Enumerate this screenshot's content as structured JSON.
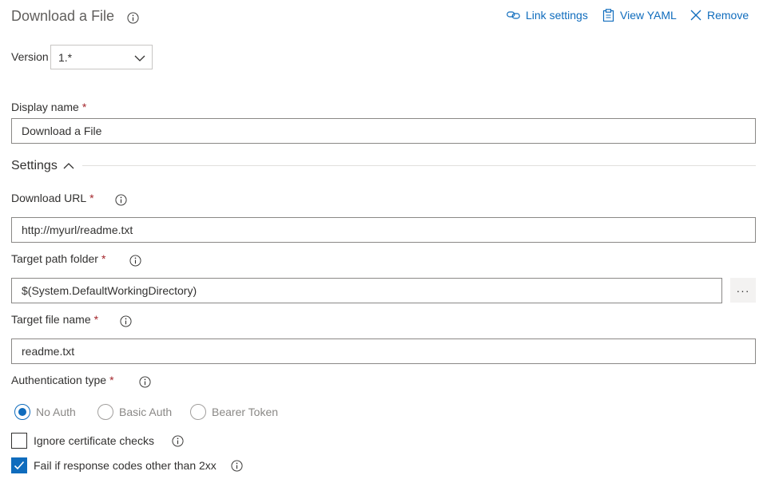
{
  "header": {
    "title": "Download a File",
    "link_settings": "Link settings",
    "view_yaml": "View YAML",
    "remove": "Remove"
  },
  "version": {
    "label": "Version",
    "value": "1.*"
  },
  "display_name": {
    "label": "Display name",
    "required_mark": "*",
    "value": "Download a File"
  },
  "settings": {
    "title": "Settings"
  },
  "download_url": {
    "label": "Download URL",
    "required_mark": "*",
    "value": "http://myurl/readme.txt"
  },
  "target_path": {
    "label": "Target path folder",
    "required_mark": "*",
    "value": "$(System.DefaultWorkingDirectory)",
    "browse_label": "···"
  },
  "target_file": {
    "label": "Target file name",
    "required_mark": "*",
    "value": "readme.txt"
  },
  "auth": {
    "label": "Authentication type",
    "required_mark": "*",
    "options": [
      "No Auth",
      "Basic Auth",
      "Bearer Token"
    ],
    "selected": "No Auth"
  },
  "checks": {
    "ignore_cert": {
      "label": "Ignore certificate checks",
      "checked": false
    },
    "fail_non_2xx": {
      "label": "Fail if response codes other than 2xx",
      "checked": true
    }
  },
  "colors": {
    "accent": "#0f6cbd",
    "required": "#a4262c",
    "border": "#8a8886"
  }
}
